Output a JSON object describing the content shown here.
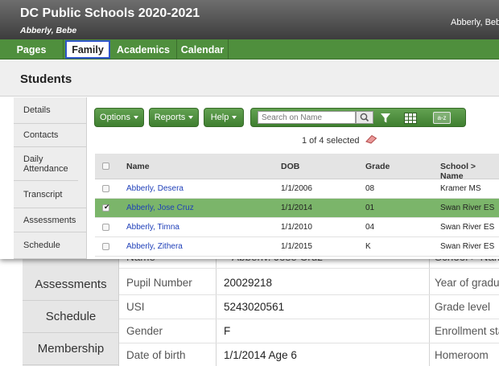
{
  "app": {
    "title": "DC Public Schools 2020-2021",
    "user": "Abberly, Bebe",
    "user_right": "Abberly, Beb"
  },
  "nav": {
    "tabs": [
      {
        "label": "Pages"
      },
      {
        "label": "Family",
        "active": true
      },
      {
        "label": "Academics"
      },
      {
        "label": "Calendar"
      }
    ]
  },
  "page": {
    "title": "Students"
  },
  "sidebar": {
    "items": [
      {
        "label": "Details"
      },
      {
        "label": "Contacts"
      },
      {
        "label": "Daily Attendance"
      },
      {
        "label": "Transcript"
      },
      {
        "label": "Assessments"
      },
      {
        "label": "Schedule"
      }
    ]
  },
  "toolbar": {
    "options_label": "Options",
    "reports_label": "Reports",
    "help_label": "Help",
    "search_placeholder": "Search on Name",
    "az_label": "a-z",
    "selection_text": "1 of 4 selected"
  },
  "table": {
    "columns": [
      "Name",
      "DOB",
      "Grade",
      "School > Name"
    ],
    "rows": [
      {
        "name": "Abberly, Desera",
        "dob": "1/1/2006",
        "grade": "08",
        "school": "Kramer MS",
        "selected": false
      },
      {
        "name": "Abberly, Jose Cruz",
        "dob": "1/1/2014",
        "grade": "01",
        "school": "Swan River ES",
        "selected": true
      },
      {
        "name": "Abberly, Timna",
        "dob": "1/1/2010",
        "grade": "04",
        "school": "Swan River ES",
        "selected": false
      },
      {
        "name": "Abberly, Zithera",
        "dob": "1/1/2015",
        "grade": "K",
        "school": "Swan River ES",
        "selected": false
      }
    ]
  },
  "detail": {
    "sidebar": [
      {
        "label": "Assessments"
      },
      {
        "label": "Schedule"
      },
      {
        "label": "Membership"
      }
    ],
    "clipped": {
      "label": "Name",
      "value": "Abberly, Jose Cruz",
      "right_label": "School > Name"
    },
    "fields": [
      {
        "label": "Pupil Number",
        "value": "20029218",
        "right_label": "Year of graduat"
      },
      {
        "label": "USI",
        "value": "5243020561",
        "right_label": "Grade level"
      },
      {
        "label": "Gender",
        "value": "F",
        "right_label": "Enrollment stat"
      },
      {
        "label": "Date of birth",
        "value": "1/1/2014  Age  6",
        "right_label": "Homeroom"
      }
    ]
  },
  "colors": {
    "nav_green": "#4f8f3d",
    "selected_row": "#7bb56a",
    "link_blue": "#1f3fb8",
    "active_tab_border": "#2e55c9"
  }
}
